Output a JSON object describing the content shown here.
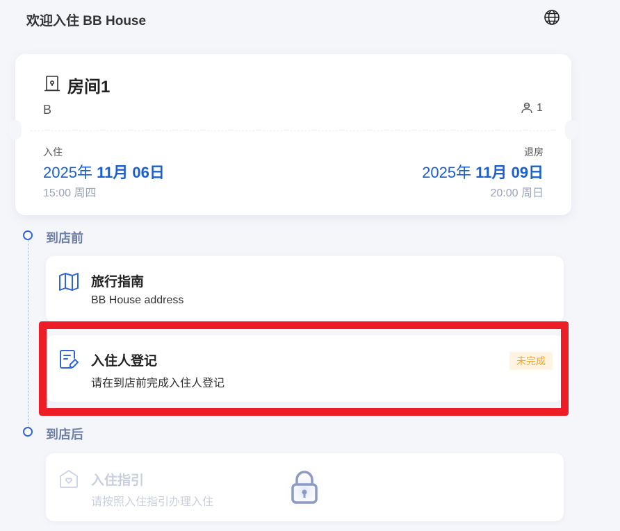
{
  "header": {
    "title": "欢迎入住 BB House",
    "language_icon": "globe-icon"
  },
  "room": {
    "name": "房间1",
    "subtitle": "B",
    "guest_count": "1",
    "checkin": {
      "label": "入住",
      "year": "2025年 ",
      "monthday": "11月 06日",
      "time": "15:00 周四"
    },
    "checkout": {
      "label": "退房",
      "year": "2025年 ",
      "monthday": "11月 09日",
      "time": "20:00 周日"
    }
  },
  "timeline": {
    "before": {
      "label": "到店前",
      "tasks": [
        {
          "title": "旅行指南",
          "desc": "BB House address",
          "icon": "map-icon"
        },
        {
          "title": "入住人登记",
          "desc": "请在到店前完成入住人登记",
          "icon": "registration-form-icon",
          "badge": "未完成"
        }
      ]
    },
    "after": {
      "label": "到店后",
      "tasks": [
        {
          "title": "入住指引",
          "desc": "请按照入住指引办理入住",
          "icon": "home-heart-icon",
          "locked": true
        }
      ]
    }
  },
  "colors": {
    "accent": "#1a5fd1",
    "badge_text": "#f5a623",
    "badge_bg": "#fff4e1",
    "highlight": "#ee1c27"
  }
}
